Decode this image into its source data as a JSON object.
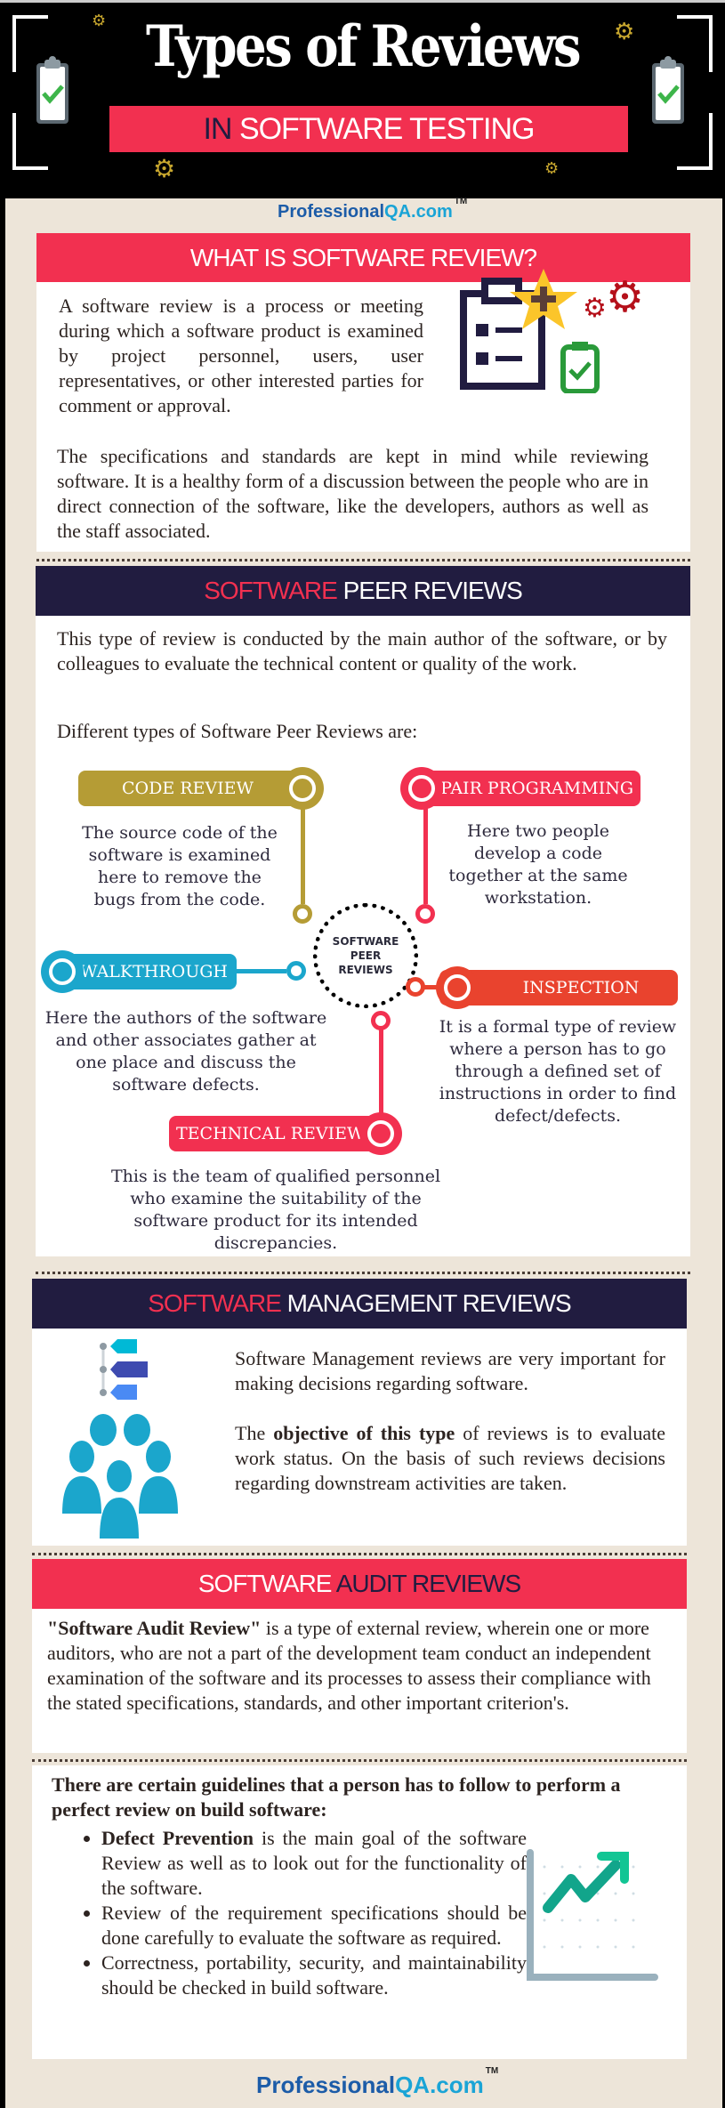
{
  "header": {
    "title": "Types of Reviews",
    "subtitle_prefix": "IN",
    "subtitle": "SOFTWARE TESTING",
    "icons": [
      "clipboard-check-icon",
      "gear-icon"
    ]
  },
  "logo": {
    "name": "Professional",
    "accent": "QA.com",
    "tm": "TM"
  },
  "what_is": {
    "heading": "WHAT IS SOFTWARE REVIEW?",
    "para1": "A software review is a process or meeting during which a software product is examined by project personnel, users, user representatives, or other interested parties for comment or approval.",
    "para2": "The specifications and standards are kept in mind while reviewing software. It is a healthy form of a discussion between the people who are in direct connection of the software, like the developers, authors as well as the staff associated."
  },
  "peer": {
    "heading_accent": "SOFTWARE",
    "heading_rest": "PEER REVIEWS",
    "intro": "This type of review is conducted by the main author of the software, or by colleagues to evaluate the technical content or quality of the work.",
    "list_intro": "Different types of Software Peer Reviews are:",
    "hub": [
      "SOFTWARE",
      "PEER",
      "REVIEWS"
    ],
    "types": [
      {
        "label": "CODE REVIEW",
        "color": "#b59c35",
        "desc": "The source code of the software is examined here to remove the bugs from the code."
      },
      {
        "label": "PAIR PROGRAMMING",
        "color": "#f23050",
        "desc": "Here two people develop a code together at the same workstation."
      },
      {
        "label": "WALKTHROUGH",
        "color": "#1ba6cc",
        "desc": "Here the authors of the software and other associates gather at one place and discuss the software defects."
      },
      {
        "label": "INSPECTION",
        "color": "#e9432e",
        "desc": "It is a formal type of review where a person has to go through a defined set of instructions in order to find defect/defects."
      },
      {
        "label": "TECHNICAL REVIEW",
        "color": "#f23050",
        "desc": "This is the team of qualified personnel who examine the suitability of the software product for its intended discrepancies."
      }
    ]
  },
  "management": {
    "heading_accent": "SOFTWARE",
    "heading_rest": "MANAGEMENT REVIEWS",
    "para1": "Software Management reviews are very important for making decisions regarding software.",
    "para2_pre": "The ",
    "para2_bold": "objective of this type",
    "para2_post": " of reviews is to evaluate work status. On the basis of such reviews decisions regarding downstream activities are taken."
  },
  "audit": {
    "heading_accent": "SOFTWARE",
    "heading_rest": "AUDIT REVIEWS",
    "bold": "\"Software Audit Review\"",
    "text": " is a type of external review, wherein one or more auditors, who are not a part of the development team conduct an independent examination of the software and its processes to assess their compliance with the stated specifications, standards, and other important criterion's."
  },
  "guidelines": {
    "intro": "There are certain guidelines that a person has to follow to perform a perfect review on build software:",
    "items": [
      {
        "bold": "Defect Prevention",
        "text": " is the main goal of the software Review as well as to look out for the functionality of the software."
      },
      {
        "bold": "",
        "text": "Review of the requirement specifications should be done carefully to evaluate the software as required."
      },
      {
        "bold": "",
        "text": "Correctness, portability, security, and maintainability should be checked in build software."
      }
    ]
  },
  "colors": {
    "red": "#f23050",
    "navy": "#211c40",
    "beige": "#ede5d9",
    "gold": "#b59c35",
    "teal": "#1ba6cc",
    "orange": "#e9432e"
  }
}
